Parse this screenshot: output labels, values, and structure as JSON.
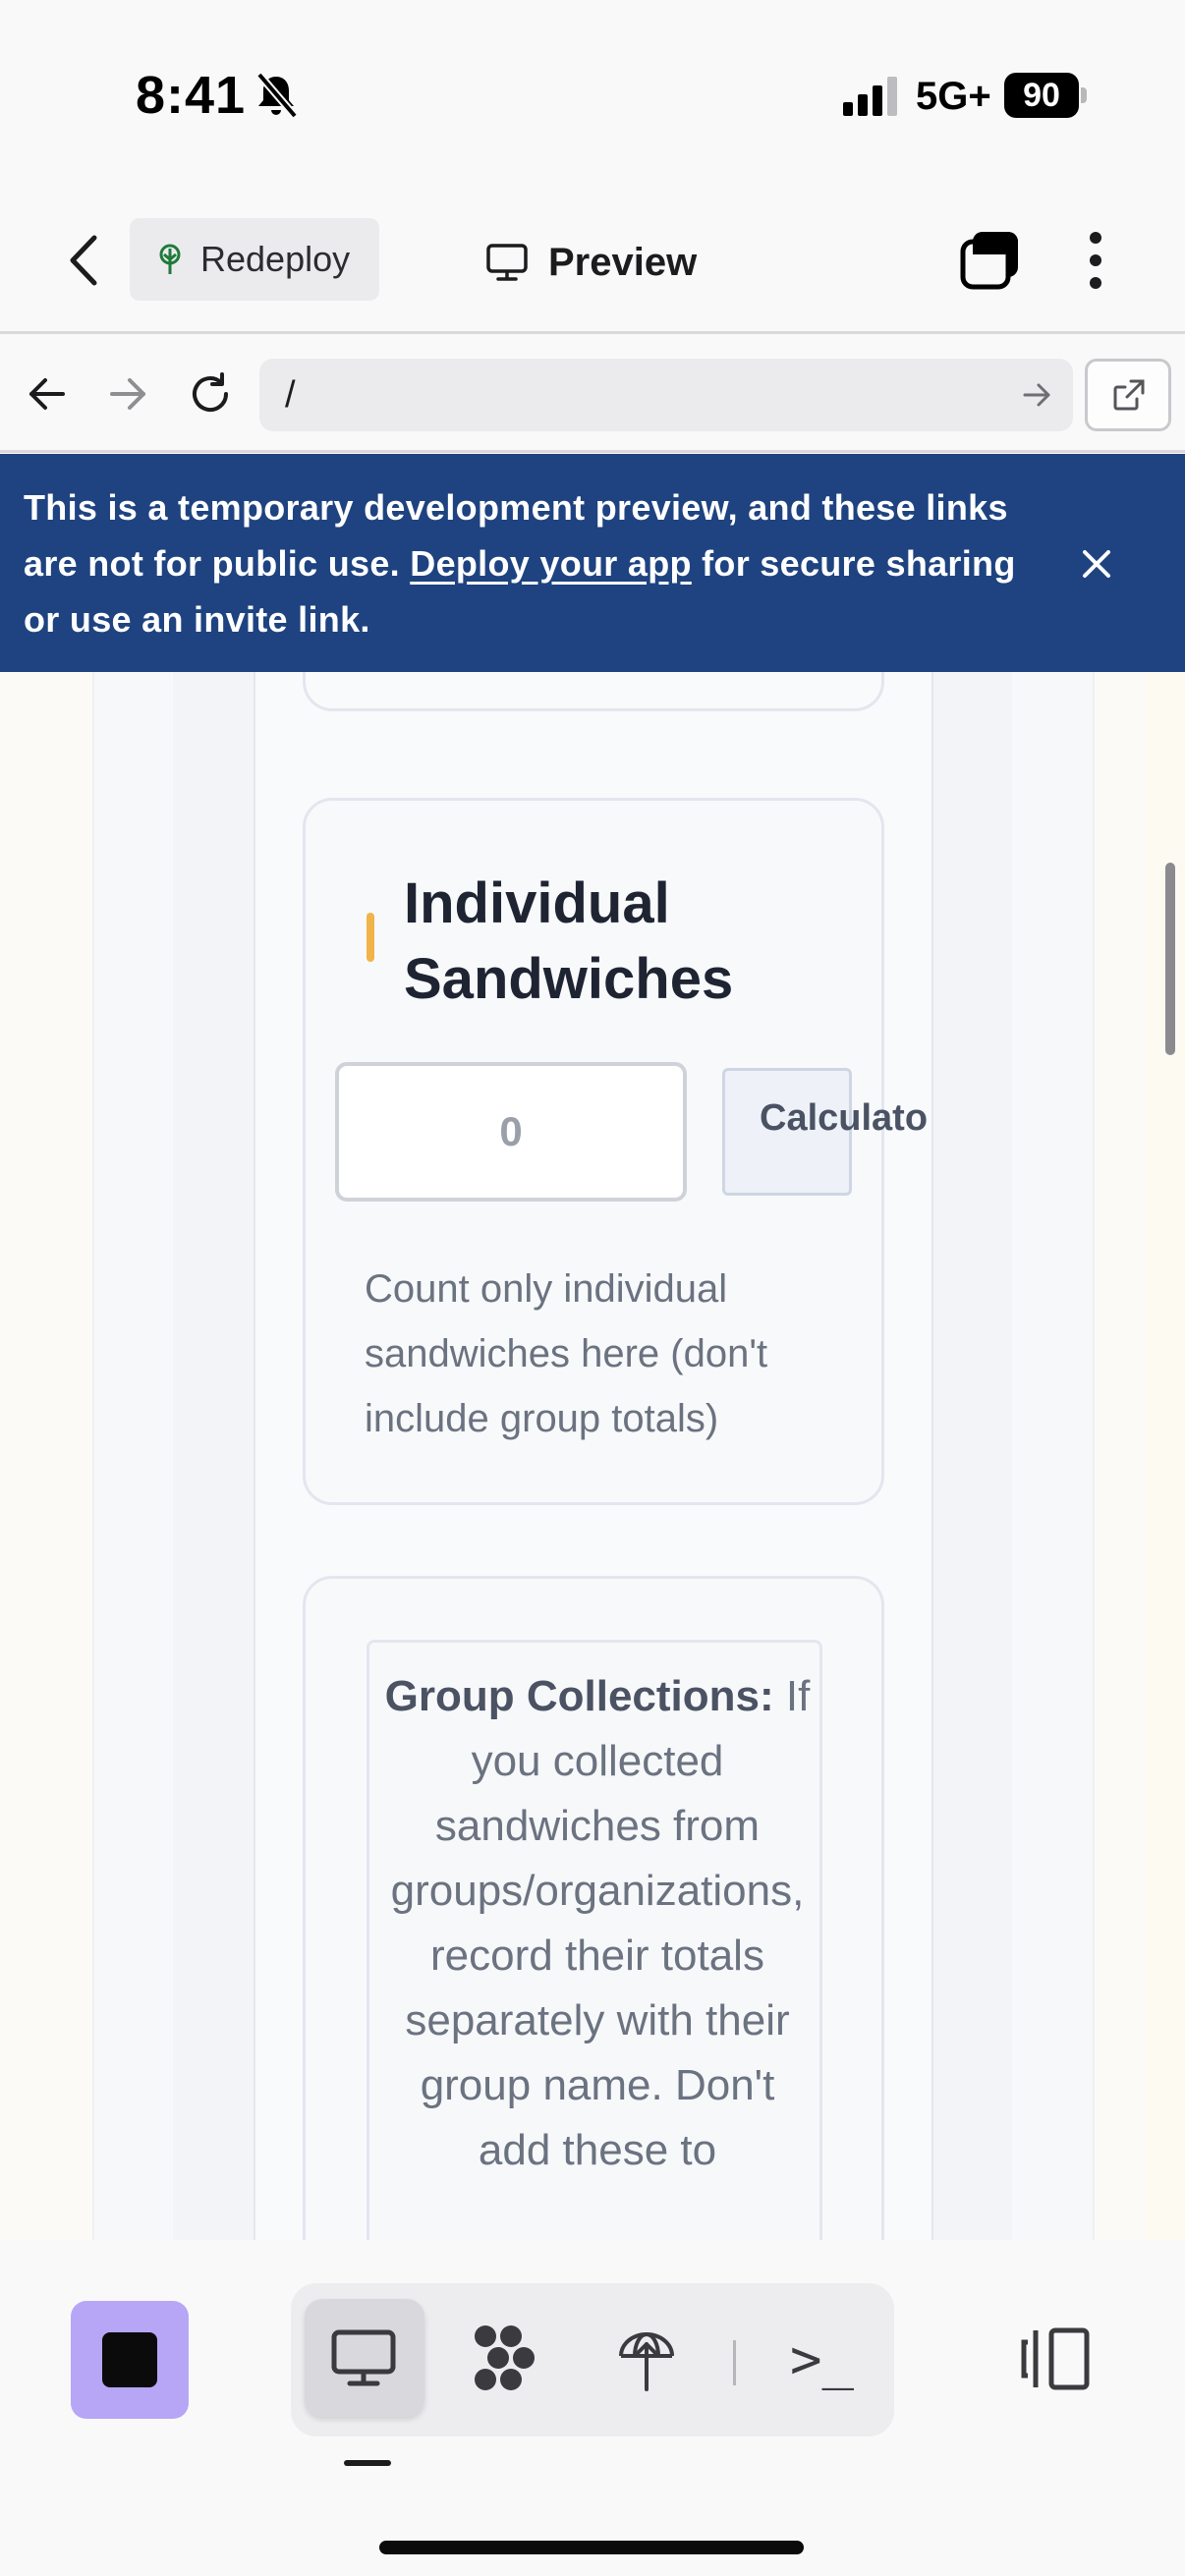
{
  "status_bar": {
    "time": "8:41",
    "network": "5G+",
    "battery": "90"
  },
  "app_bar": {
    "redeploy_label": "Redeploy",
    "preview_label": "Preview"
  },
  "url_bar": {
    "url": "/"
  },
  "banner": {
    "text_before": "This is a temporary development preview, and these links are not for public use. ",
    "link": "Deploy your app",
    "text_after": " for secure sharing or use an invite link."
  },
  "individual_card": {
    "title": "Individual Sandwiches",
    "input_placeholder": "0",
    "calculator_label": "Calculato",
    "help_text": "Count only individual sandwiches here (don't include group totals)"
  },
  "group_card": {
    "notice_heading": "Group Collections:",
    "notice_body": " If you collected sandwiches from groups/organizations, record their totals separately with their group name. Don't add these to"
  },
  "colors": {
    "banner_bg": "#1e4380",
    "accent": "#f0b44a",
    "stop_button": "#b7a6f6"
  },
  "toolbar": {
    "terminal_label": ">_",
    "icons": [
      "stop-icon",
      "desktop-icon",
      "workflow-icon",
      "deploy-icon",
      "terminal-icon",
      "panel-toggle-icon"
    ]
  }
}
